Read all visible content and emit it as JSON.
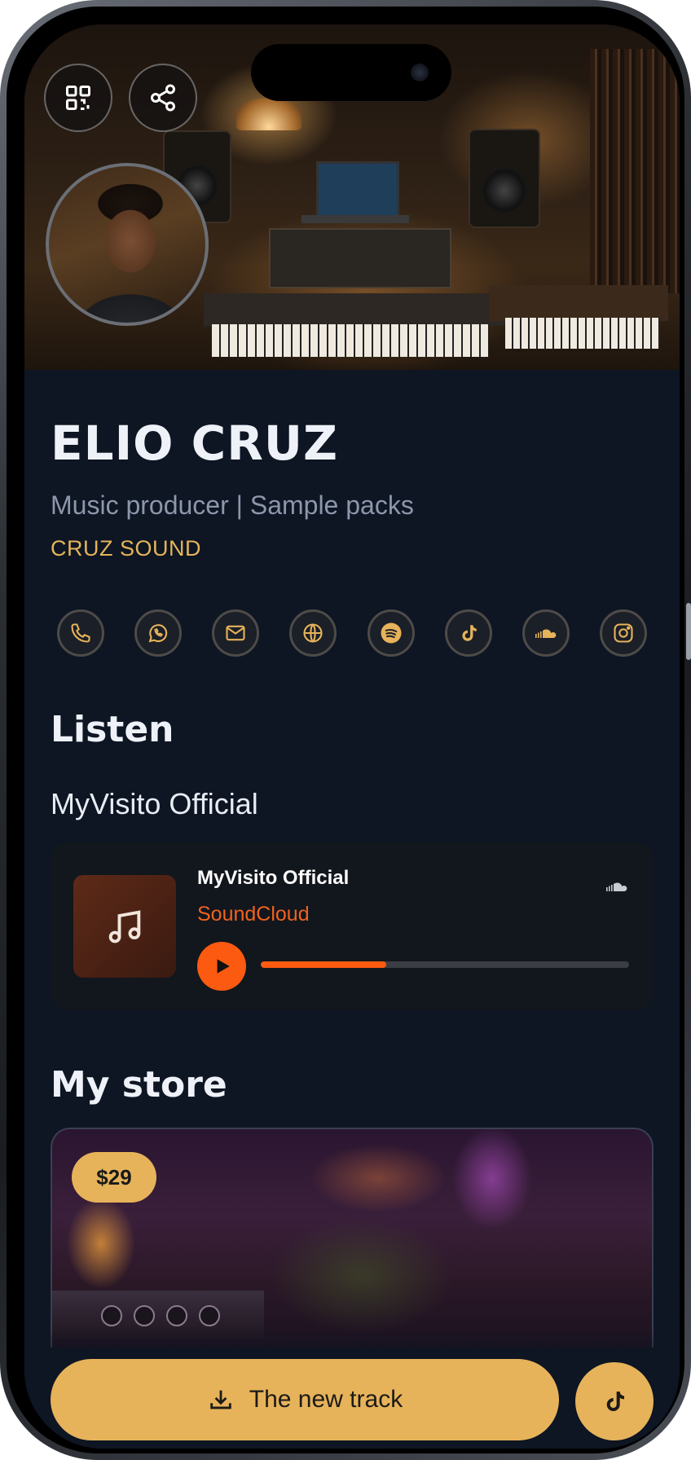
{
  "profile": {
    "name": "ELIO CRUZ",
    "tagline": "Music producer | Sample packs",
    "company": "CRUZ SOUND"
  },
  "header": {
    "qr_icon": "qr-code-icon",
    "share_icon": "share-icon"
  },
  "socials": [
    {
      "name": "phone",
      "icon": "phone-icon"
    },
    {
      "name": "whatsapp",
      "icon": "whatsapp-icon"
    },
    {
      "name": "email",
      "icon": "mail-icon"
    },
    {
      "name": "website",
      "icon": "globe-icon"
    },
    {
      "name": "spotify",
      "icon": "spotify-icon"
    },
    {
      "name": "tiktok",
      "icon": "tiktok-icon"
    },
    {
      "name": "soundcloud",
      "icon": "soundcloud-icon"
    },
    {
      "name": "instagram",
      "icon": "instagram-icon"
    }
  ],
  "listen": {
    "title": "Listen",
    "subtitle": "MyVisito Official",
    "player": {
      "track_title": "MyVisito Official",
      "source": "SoundCloud",
      "progress": 0.34
    }
  },
  "store": {
    "title": "My store",
    "price": "$29"
  },
  "cta": {
    "label": "The new track",
    "fab_icon": "tiktok-icon"
  },
  "colors": {
    "accent": "#e6b35a",
    "background": "#0e1523",
    "soundcloud": "#fb5a10"
  }
}
